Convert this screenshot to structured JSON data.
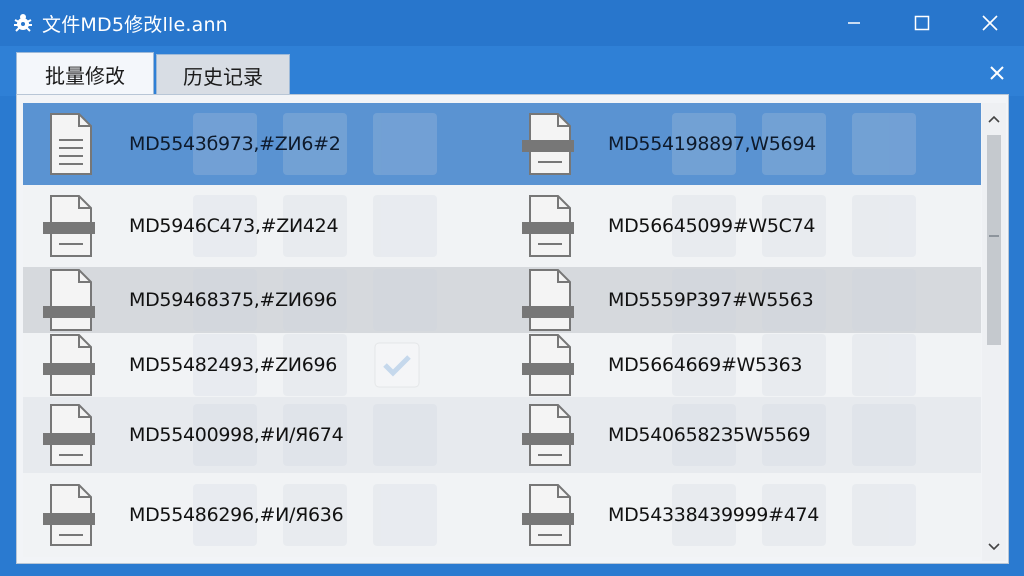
{
  "window": {
    "title": "文件MD5修改lle.ann",
    "icon": "app-bug-icon"
  },
  "tabs": [
    {
      "label": "批量修改",
      "active": true
    },
    {
      "label": "历史记录",
      "active": false
    }
  ],
  "files": {
    "rows": [
      {
        "left": "MD5543б973,#ZИ6#2",
        "right": "MD554198897,W5694",
        "style": "selected"
      },
      {
        "left": "MD5946C473,#ZИ424",
        "right": "MD56645099#W5C74",
        "style": "light"
      },
      {
        "left": "MD59468375,#ZИ696",
        "right": "MD5559Р397#W5563",
        "style": "dark"
      },
      {
        "left": "MD55482493,#ZИ696",
        "right": "MD5664669#W5363",
        "style": "light"
      },
      {
        "left": "MD55400998,#И/Я674",
        "right": "MD5406582З5W5569",
        "style": "alt"
      },
      {
        "left": "MD55486296,#И/Я636",
        "right": "MD54338439999#474",
        "style": "light"
      }
    ]
  },
  "colors": {
    "titlebar": "#2876cc",
    "selection": "#5a93d2",
    "panel": "#f2f4f7"
  }
}
